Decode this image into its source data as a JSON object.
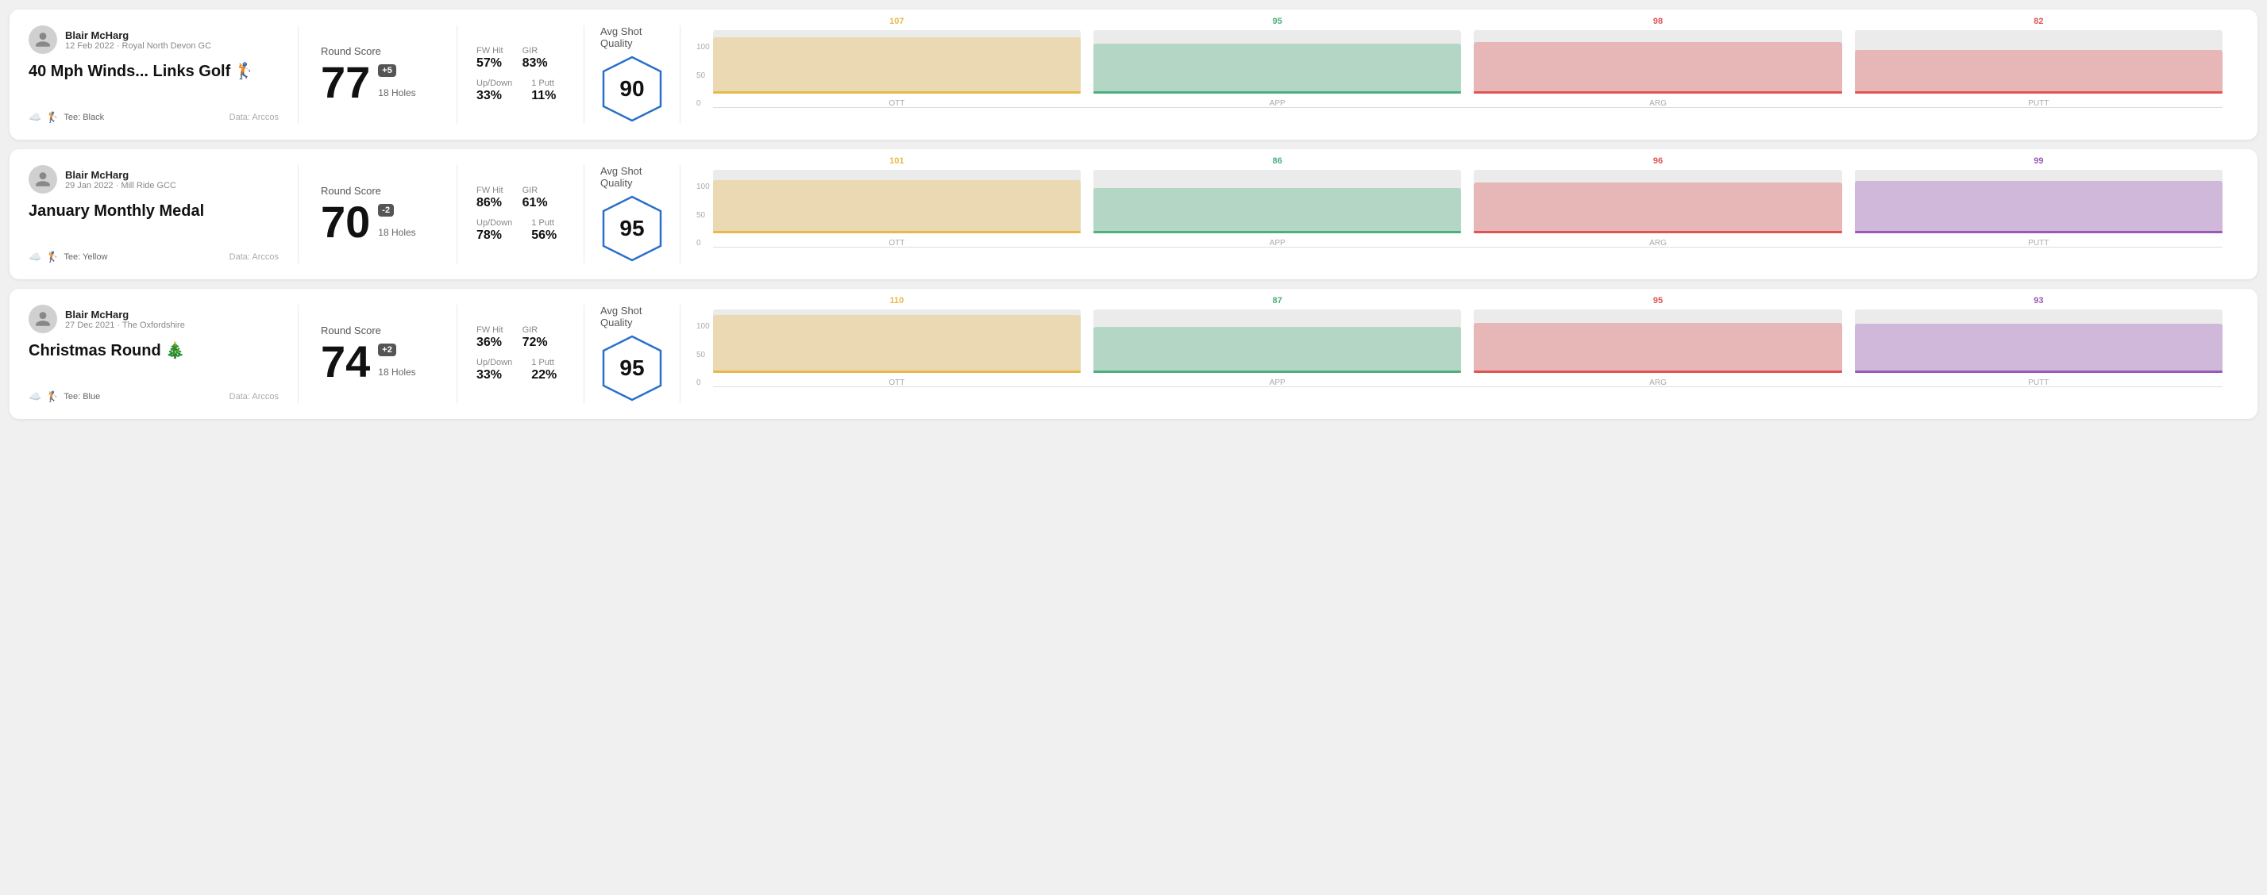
{
  "rounds": [
    {
      "id": "round-1",
      "user": {
        "name": "Blair McHarg",
        "date": "12 Feb 2022 · Royal North Devon GC"
      },
      "title": "40 Mph Winds... Links Golf 🏌",
      "tee": "Black",
      "data_source": "Data: Arccos",
      "score": "77",
      "score_diff": "+5",
      "holes": "18 Holes",
      "fw_hit": "57%",
      "gir": "83%",
      "up_down": "33%",
      "one_putt": "11%",
      "avg_quality_label": "Avg Shot Quality",
      "quality_score": "90",
      "chart": {
        "bars": [
          {
            "label": "OTT",
            "value": 107,
            "color": "#e8b84b"
          },
          {
            "label": "APP",
            "value": 95,
            "color": "#4caf7d"
          },
          {
            "label": "ARG",
            "value": 98,
            "color": "#e05454"
          },
          {
            "label": "PUTT",
            "value": 82,
            "color": "#e05454"
          }
        ],
        "max": 120
      }
    },
    {
      "id": "round-2",
      "user": {
        "name": "Blair McHarg",
        "date": "29 Jan 2022 · Mill Ride GCC"
      },
      "title": "January Monthly Medal",
      "tee": "Yellow",
      "data_source": "Data: Arccos",
      "score": "70",
      "score_diff": "-2",
      "holes": "18 Holes",
      "fw_hit": "86%",
      "gir": "61%",
      "up_down": "78%",
      "one_putt": "56%",
      "avg_quality_label": "Avg Shot Quality",
      "quality_score": "95",
      "chart": {
        "bars": [
          {
            "label": "OTT",
            "value": 101,
            "color": "#e8b84b"
          },
          {
            "label": "APP",
            "value": 86,
            "color": "#4caf7d"
          },
          {
            "label": "ARG",
            "value": 96,
            "color": "#e05454"
          },
          {
            "label": "PUTT",
            "value": 99,
            "color": "#9b59b6"
          }
        ],
        "max": 120
      }
    },
    {
      "id": "round-3",
      "user": {
        "name": "Blair McHarg",
        "date": "27 Dec 2021 · The Oxfordshire"
      },
      "title": "Christmas Round 🎄",
      "tee": "Blue",
      "data_source": "Data: Arccos",
      "score": "74",
      "score_diff": "+2",
      "holes": "18 Holes",
      "fw_hit": "36%",
      "gir": "72%",
      "up_down": "33%",
      "one_putt": "22%",
      "avg_quality_label": "Avg Shot Quality",
      "quality_score": "95",
      "chart": {
        "bars": [
          {
            "label": "OTT",
            "value": 110,
            "color": "#e8b84b"
          },
          {
            "label": "APP",
            "value": 87,
            "color": "#4caf7d"
          },
          {
            "label": "ARG",
            "value": 95,
            "color": "#e05454"
          },
          {
            "label": "PUTT",
            "value": 93,
            "color": "#9b59b6"
          }
        ],
        "max": 120
      }
    }
  ],
  "labels": {
    "round_score": "Round Score",
    "fw_hit": "FW Hit",
    "gir": "GIR",
    "up_down": "Up/Down",
    "one_putt": "1 Putt",
    "tee_prefix": "Tee: ",
    "y_axis": [
      "100",
      "50",
      "0"
    ]
  }
}
